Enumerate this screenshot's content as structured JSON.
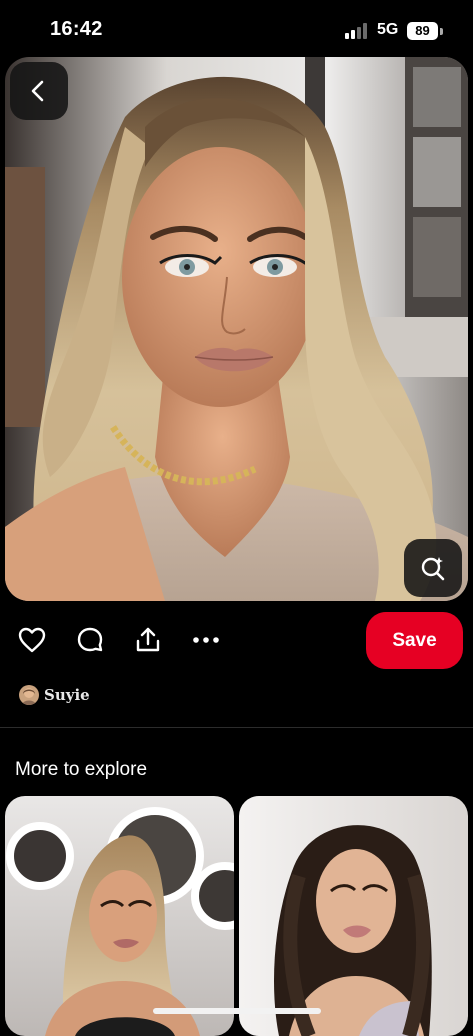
{
  "status_bar": {
    "time": "16:42",
    "network": "5G",
    "battery": "89",
    "signal_icon": "signal-bars-icon"
  },
  "pin": {
    "image_subject": "portrait of a woman with wavy blonde hair, glam makeup and a gold chain necklace",
    "back_icon": "chevron-left-icon",
    "lens_icon": "visual-search-icon"
  },
  "actions": {
    "like_icon": "heart-icon",
    "comment_icon": "comment-bubble-icon",
    "share_icon": "share-icon",
    "more_icon": "more-dots-icon",
    "save_label": "Save",
    "save_color": "#e60023"
  },
  "creator": {
    "name": "Suyie"
  },
  "explore": {
    "heading": "More to explore",
    "cards": [
      {
        "subject": "blonde high ponytail hairstyle in a salon with ring lights"
      },
      {
        "subject": "dark half-up wavy hairstyle with sparkly dress"
      }
    ]
  }
}
